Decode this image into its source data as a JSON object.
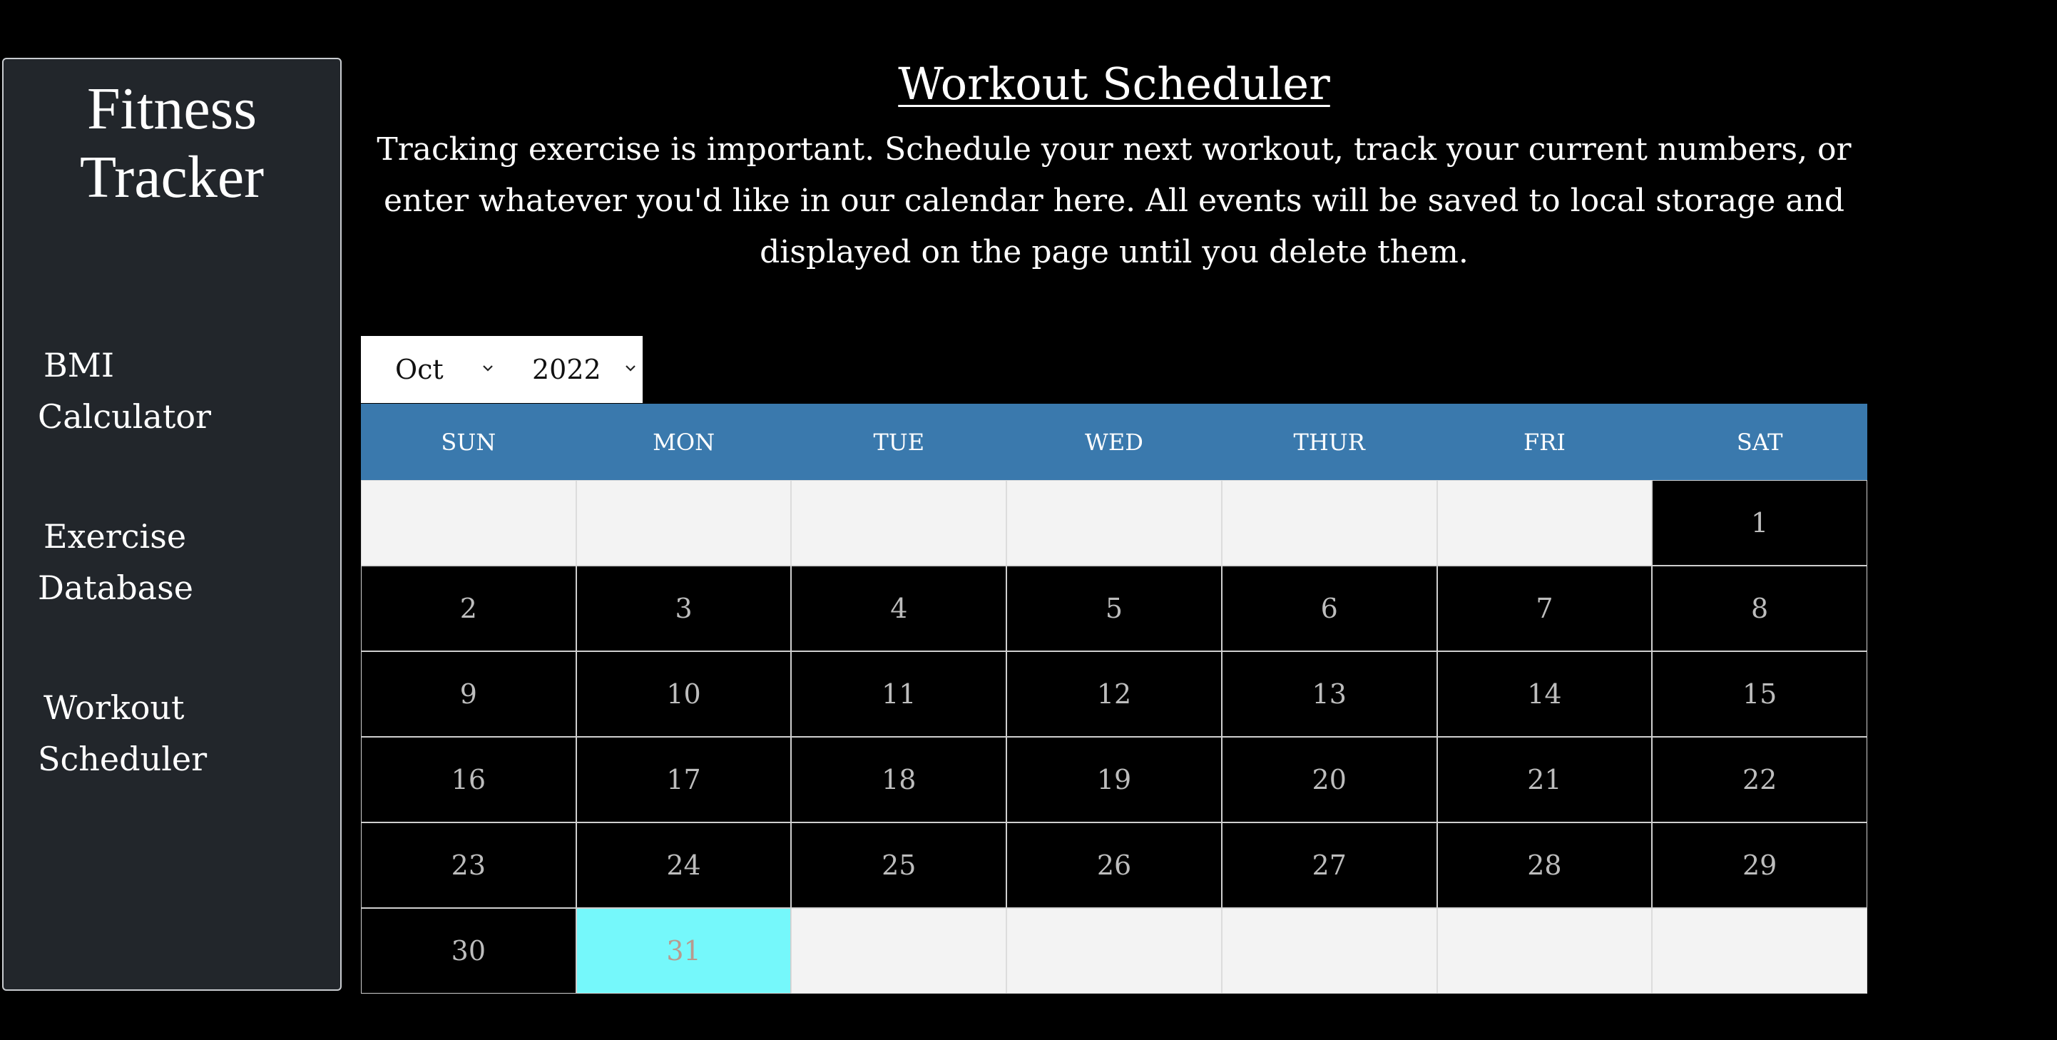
{
  "sidebar": {
    "brand_line1": "Fitness",
    "brand_line2": "Tracker",
    "items": [
      {
        "line1": "BMI",
        "line2": "Calculator"
      },
      {
        "line1": "Exercise",
        "line2": "Database"
      },
      {
        "line1": "Workout",
        "line2": "Scheduler"
      }
    ]
  },
  "main": {
    "title": "Workout Scheduler",
    "intro": "Tracking exercise is important. Schedule your next workout, track your current numbers, or enter whatever you'd like in our calendar here. All events will be saved to local storage and displayed on the page until you delete them."
  },
  "selectors": {
    "month": "Oct",
    "year": "2022"
  },
  "calendar": {
    "weekdays": [
      "SUN",
      "MON",
      "TUE",
      "WED",
      "THUR",
      "FRI",
      "SAT"
    ],
    "leading_blanks": 6,
    "days_in_month": 31,
    "today": 31,
    "colors": {
      "header_bg": "#3a79ad",
      "today_bg": "#75f8fb",
      "blank_bg": "#f3f3f3",
      "day_bg": "#000000"
    }
  },
  "icons": {
    "month_dropdown": "chevron-down-icon",
    "year_dropdown": "chevron-down-icon"
  }
}
